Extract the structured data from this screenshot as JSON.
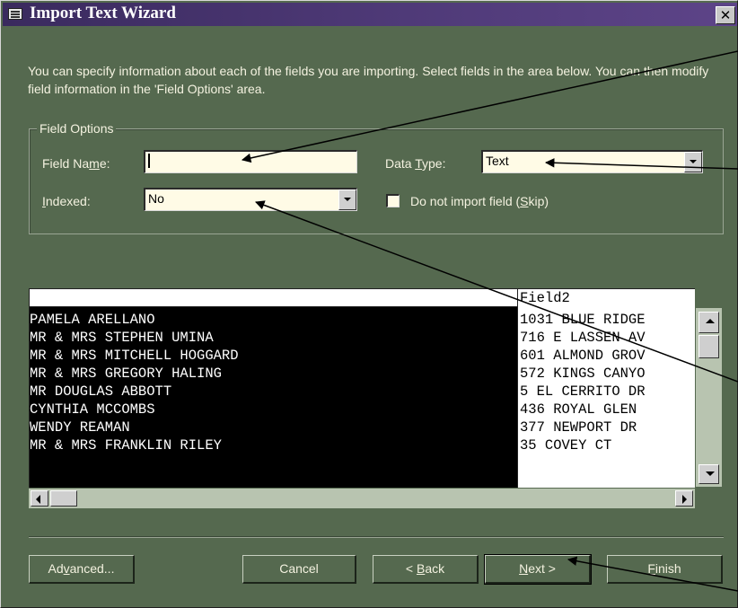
{
  "window": {
    "title": "Import Text Wizard",
    "close_glyph": "✕"
  },
  "description": "You can specify information about each of the fields you are importing.  Select fields in the area below. You can then modify field information in the 'Field Options' area.",
  "field_options": {
    "group_label": "Field Options",
    "field_name_pre": "Field Na",
    "field_name_u": "m",
    "field_name_post": "e:",
    "field_name_value": "",
    "data_type_pre": "Data ",
    "data_type_u": "T",
    "data_type_post": "ype:",
    "data_type_value": "Text",
    "indexed_u": "I",
    "indexed_post": "ndexed:",
    "indexed_value": "No",
    "skip_pre": "Do not import field (",
    "skip_u": "S",
    "skip_post": "kip)",
    "skip_checked": false
  },
  "grid": {
    "columns": [
      "",
      "Field2"
    ],
    "rows": [
      [
        "PAMELA ARELLANO",
        "1031 BLUE RIDGE"
      ],
      [
        "MR & MRS STEPHEN UMINA",
        "716 E LASSEN AV"
      ],
      [
        "MR & MRS MITCHELL HOGGARD",
        "601 ALMOND GROV"
      ],
      [
        "MR & MRS GREGORY HALING",
        "572 KINGS CANYO"
      ],
      [
        "MR DOUGLAS ABBOTT",
        "5 EL CERRITO DR"
      ],
      [
        "CYNTHIA MCCOMBS",
        "436 ROYAL GLEN"
      ],
      [
        "WENDY REAMAN",
        "377 NEWPORT DR"
      ],
      [
        "MR & MRS FRANKLIN RILEY",
        "35 COVEY CT"
      ]
    ],
    "selected_column": 0
  },
  "buttons": {
    "advanced_pre": "Ad",
    "advanced_u": "v",
    "advanced_post": "anced...",
    "cancel": "Cancel",
    "back_pre": "< ",
    "back_u": "B",
    "back_post": "ack",
    "next_u": "N",
    "next_post": "ext >",
    "finish_u": "F",
    "finish_post": "inish"
  },
  "colors": {
    "window_bg": "#55694f",
    "titlebar": "#4f3a78",
    "field_bg": "#fffbe6",
    "selected_column_bg": "#000000",
    "annotation_arrow": "#000000"
  }
}
